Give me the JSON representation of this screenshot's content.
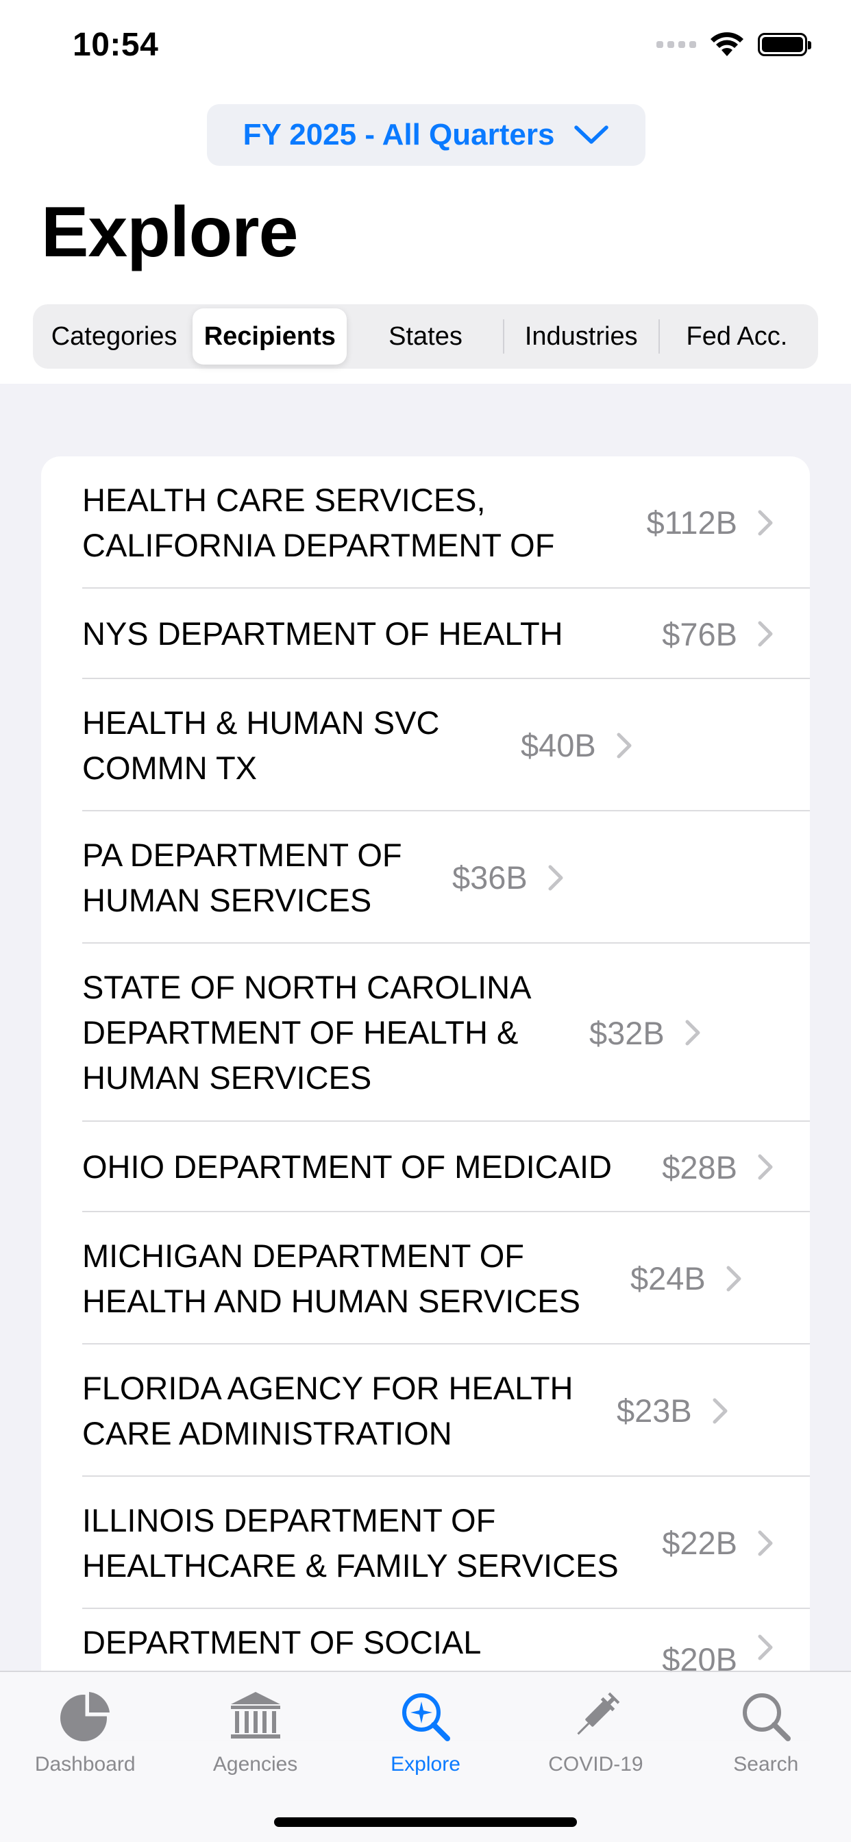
{
  "status_bar": {
    "time": "10:54"
  },
  "period_selector": {
    "label": "FY 2025 - All Quarters",
    "icon": "chevron-down-icon"
  },
  "page_title": "Explore",
  "segments": [
    {
      "label": "Categories",
      "selected": false
    },
    {
      "label": "Recipients",
      "selected": true
    },
    {
      "label": "States",
      "selected": false
    },
    {
      "label": "Industries",
      "selected": false
    },
    {
      "label": "Fed Acc.",
      "selected": false
    }
  ],
  "recipients": [
    {
      "name": "HEALTH CARE SERVICES, CALIFORNIA DEPARTMENT OF",
      "amount": "$112B"
    },
    {
      "name": "NYS DEPARTMENT OF HEALTH",
      "amount": "$76B"
    },
    {
      "name": "HEALTH & HUMAN SVC COMMN TX",
      "amount": "$40B"
    },
    {
      "name": "PA DEPARTMENT OF HUMAN SERVICES",
      "amount": "$36B"
    },
    {
      "name": "STATE OF NORTH CAROLINA DEPARTMENT OF HEALTH & HUMAN SERVICES",
      "amount": "$32B"
    },
    {
      "name": "OHIO DEPARTMENT OF MEDICAID",
      "amount": "$28B"
    },
    {
      "name": "MICHIGAN DEPARTMENT OF HEALTH AND HUMAN SERVICES",
      "amount": "$24B"
    },
    {
      "name": "FLORIDA AGENCY FOR HEALTH CARE ADMINISTRATION",
      "amount": "$23B"
    },
    {
      "name": "ILLINOIS DEPARTMENT OF HEALTHCARE & FAMILY SERVICES",
      "amount": "$22B"
    },
    {
      "name": "DEPARTMENT OF SOCIAL",
      "amount": "$20B"
    }
  ],
  "tabs": [
    {
      "label": "Dashboard",
      "icon": "pie-chart-icon",
      "active": false
    },
    {
      "label": "Agencies",
      "icon": "building-columns-icon",
      "active": false
    },
    {
      "label": "Explore",
      "icon": "magnifier-sparkle-icon",
      "active": true
    },
    {
      "label": "COVID-19",
      "icon": "syringe-icon",
      "active": false
    },
    {
      "label": "Search",
      "icon": "search-icon",
      "active": false
    }
  ],
  "colors": {
    "accent": "#0a7aff",
    "secondary_text": "#8a8a8e",
    "background": "#f2f2f7"
  }
}
